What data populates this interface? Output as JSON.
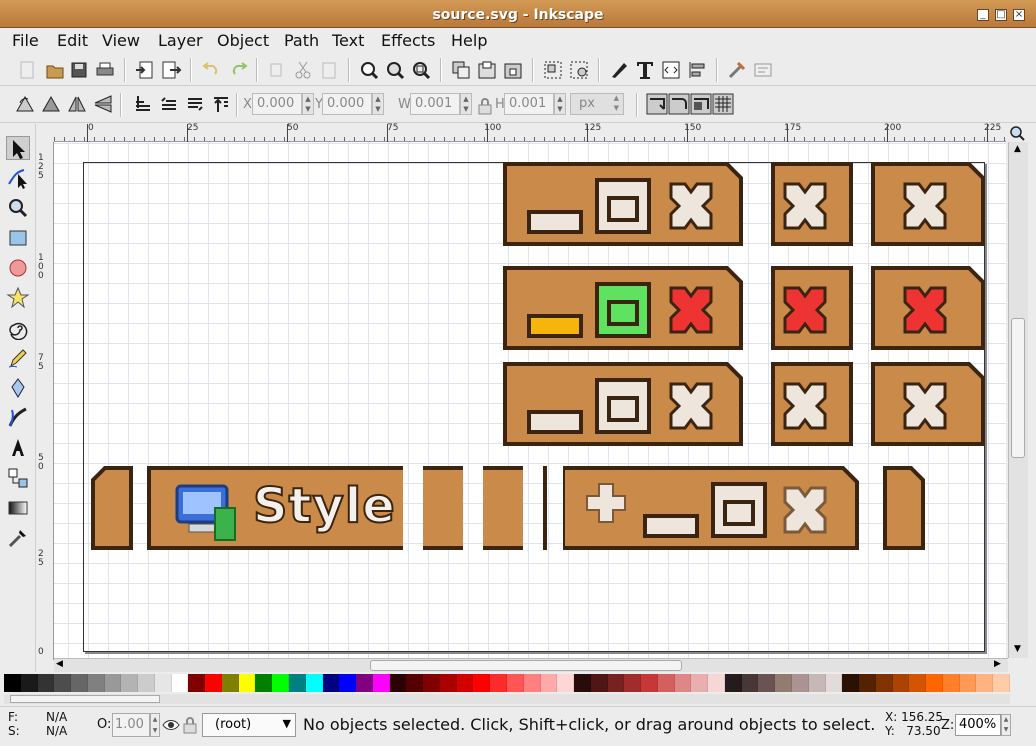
{
  "window": {
    "title": "source.svg - Inkscape",
    "controls": [
      "_",
      "□",
      "×"
    ]
  },
  "menu": [
    "File",
    "Edit",
    "View",
    "Layer",
    "Object",
    "Path",
    "Text",
    "Effects",
    "Help"
  ],
  "controlbar": {
    "x_label": "X",
    "x_value": "0.000",
    "y_label": "Y",
    "y_value": "0.000",
    "w_label": "W",
    "w_value": "0.001",
    "h_label": "H",
    "h_value": "0.001",
    "unit": "px"
  },
  "ruler": {
    "h_labels": [
      "0",
      "25",
      "50",
      "75",
      "100",
      "125",
      "150",
      "175",
      "200",
      "225"
    ],
    "v_labels": [
      "1 2 5",
      "1 0 0",
      "7 5",
      "5 0",
      "2 5",
      "0"
    ]
  },
  "canvas_text": {
    "style_label": "Style"
  },
  "colors": {
    "accent": "#c98a4a",
    "outline": "#3b2410",
    "hover_red": "#ee3333",
    "hover_green": "#5fe25f",
    "hover_yellow": "#f5b50a"
  },
  "palette": [
    "#000000",
    "#1a1a1a",
    "#333333",
    "#4d4d4d",
    "#666666",
    "#808080",
    "#999999",
    "#b3b3b3",
    "#cccccc",
    "#e6e6e6",
    "#ffffff",
    "#800000",
    "#ff0000",
    "#808000",
    "#ffff00",
    "#008000",
    "#00ff00",
    "#008080",
    "#00ffff",
    "#000080",
    "#0000ff",
    "#800080",
    "#ff00ff",
    "#2b0000",
    "#550000",
    "#800000",
    "#aa0000",
    "#d40000",
    "#ff0000",
    "#ff2a2a",
    "#ff5555",
    "#ff8080",
    "#ffaaaa",
    "#ffd5d5",
    "#280b0b",
    "#501616",
    "#782121",
    "#a02c2c",
    "#c83737",
    "#d35f5f",
    "#de8787",
    "#e9afaf",
    "#f4d7d7",
    "#241c1c",
    "#483737",
    "#6c5353",
    "#917c6f",
    "#ac9393",
    "#c8b7b7",
    "#e3dbdb",
    "#2b1100",
    "#552200",
    "#803300",
    "#aa4400",
    "#d45500",
    "#ff6600",
    "#ff7f2a",
    "#ff9955",
    "#ffb380",
    "#ffccaa"
  ],
  "status": {
    "fill_label": "F:",
    "fill_value": "N/A",
    "stroke_label": "S:",
    "stroke_value": "N/A",
    "opacity_label": "O:",
    "opacity_value": "1.00",
    "layer": "(root)",
    "message": "No objects selected. Click, Shift+click, or drag around objects to select.",
    "x_coord": "X: 156.25",
    "y_coord": "Y:   73.50",
    "zoom_label": "Z:",
    "zoom": "400%"
  }
}
